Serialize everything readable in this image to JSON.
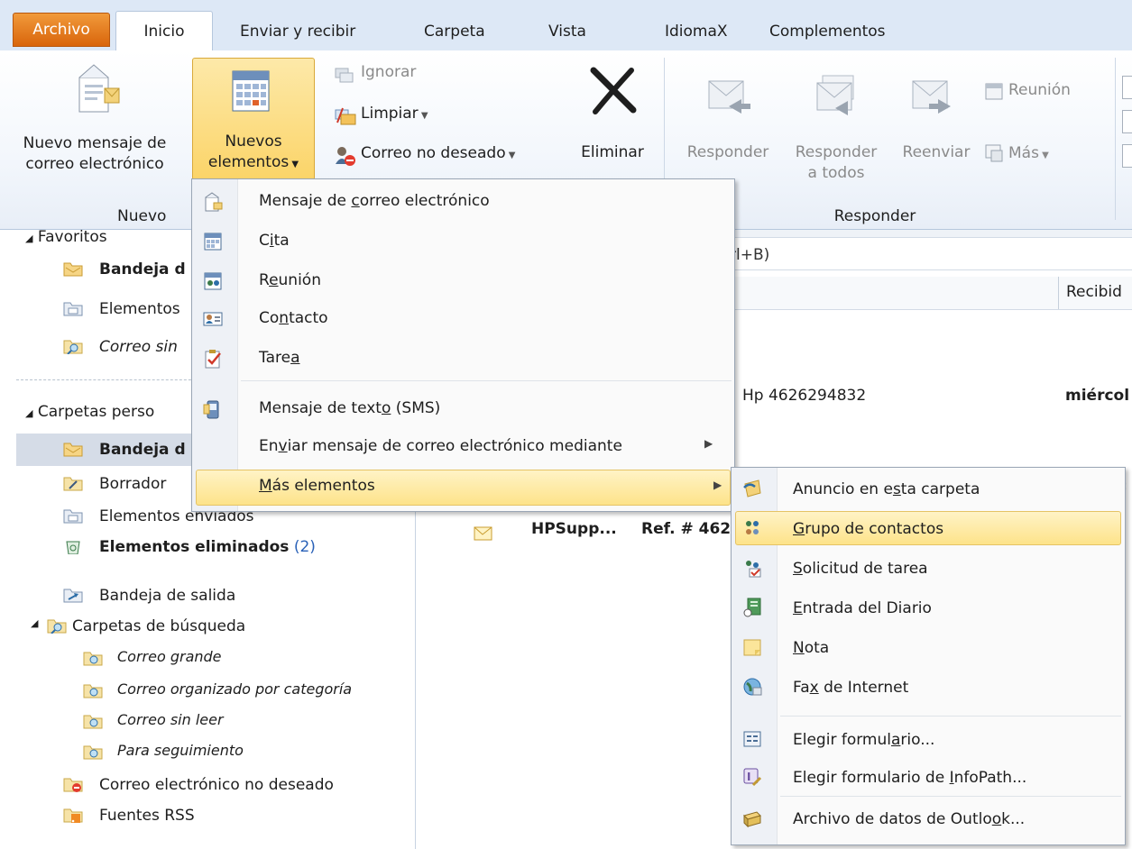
{
  "tabs": [
    "Archivo",
    "Inicio",
    "Enviar y recibir",
    "Carpeta",
    "Vista",
    "IdiomaX",
    "Complementos"
  ],
  "ribbon": {
    "nuevo_mensaje_1": "Nuevo mensaje de",
    "nuevo_mensaje_2": "correo electrónico",
    "nuevos_elementos_1": "Nuevos",
    "nuevos_elementos_2": "elementos",
    "ignorar": "Ignorar",
    "limpiar": "Limpiar",
    "correo_no_deseado": "Correo no deseado",
    "eliminar": "Eliminar",
    "responder": "Responder",
    "responder_todos_1": "Responder",
    "responder_todos_2": "a todos",
    "reenviar": "Reenviar",
    "reunion": "Reunión",
    "mas": "Más",
    "group_nuevo": "Nuevo",
    "group_responder": "Responder"
  },
  "nav": {
    "favoritos": "Favoritos",
    "bandeja_fav": "Bandeja d",
    "elementos_fav": "Elementos",
    "correo_sin_fav": "Correo sin",
    "carpetas_personales": "Carpetas perso",
    "bandeja": "Bandeja d",
    "borrador": "Borrador",
    "enviados": "Elementos enviados",
    "eliminados": "Elementos eliminados",
    "eliminados_count": "(2)",
    "salida": "Bandeja de salida",
    "busqueda": "Carpetas de búsqueda",
    "correo_grande": "Correo grande",
    "correo_categoria": "Correo organizado por categoría",
    "correo_sin_leer": "Correo sin leer",
    "seguimiento": "Para seguimiento",
    "no_deseado": "Correo electrónico no deseado",
    "rss": "Fuentes RSS"
  },
  "content": {
    "search_hint": "rl+B)",
    "col_recibido": "Recibid",
    "row1_from": "Hp 4626294832",
    "row1_date": "miércol",
    "row2_from": "HPSupp...",
    "row2_subject": "Ref. # 462"
  },
  "menu1": [
    {
      "pre": "Mensaje de ",
      "u": "c",
      "post": "orreo electrónico",
      "icon": "email-message-icon"
    },
    {
      "pre": "C",
      "u": "i",
      "post": "ta",
      "icon": "appointment-icon"
    },
    {
      "pre": "R",
      "u": "e",
      "post": "unión",
      "icon": "meeting-icon"
    },
    {
      "pre": "Co",
      "u": "n",
      "post": "tacto",
      "icon": "contact-icon"
    },
    {
      "pre": "Tare",
      "u": "a",
      "post": "",
      "icon": "task-icon"
    },
    {
      "pre": "Mensaje de text",
      "u": "o",
      "post": " (SMS)",
      "icon": "sms-icon"
    },
    {
      "pre": "En",
      "u": "v",
      "post": "iar mensaje de correo electrónico mediante",
      "icon": ""
    },
    {
      "pre": "",
      "u": "M",
      "post": "ás elementos",
      "icon": ""
    }
  ],
  "menu2": [
    {
      "pre": "Anuncio en e",
      "u": "s",
      "post": "ta carpeta",
      "icon": "post-icon"
    },
    {
      "pre": "",
      "u": "G",
      "post": "rupo de contactos",
      "icon": "contact-group-icon"
    },
    {
      "pre": "",
      "u": "S",
      "post": "olicitud de tarea",
      "icon": "task-request-icon"
    },
    {
      "pre": "",
      "u": "E",
      "post": "ntrada del Diario",
      "icon": "journal-entry-icon"
    },
    {
      "pre": "",
      "u": "N",
      "post": "ota",
      "icon": "note-icon"
    },
    {
      "pre": "Fa",
      "u": "x",
      "post": " de Internet",
      "icon": "internet-fax-icon"
    },
    {
      "pre": "Elegir formul",
      "u": "a",
      "post": "rio...",
      "icon": "choose-form-icon"
    },
    {
      "pre": "Elegir formulario de ",
      "u": "I",
      "post": "nfoPath...",
      "icon": "infopath-icon"
    },
    {
      "pre": "Archivo de datos de Outlo",
      "u": "o",
      "post": "k...",
      "icon": "data-file-icon"
    }
  ],
  "colors": {
    "accent": "#fde38a",
    "file_tab": "#e5801f",
    "count": "#2a62b8"
  }
}
